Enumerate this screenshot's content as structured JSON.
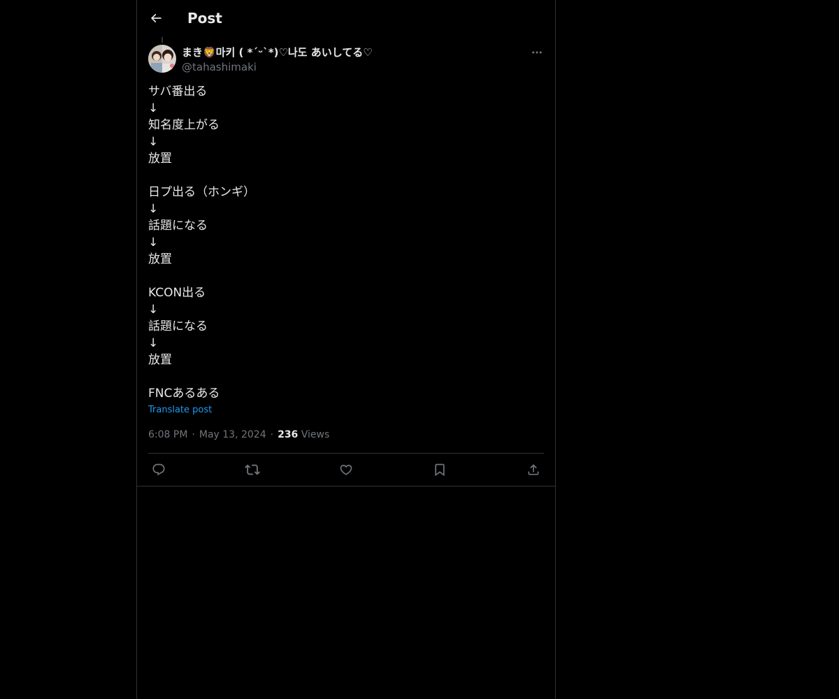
{
  "header": {
    "title": "Post",
    "back_icon": "back-arrow-icon"
  },
  "author": {
    "display_name": "まき🦁마키 ( *´ᵕ`*)♡나도 あいしてる♡",
    "handle": "@tahashimaki",
    "avatar": "avatar-photo"
  },
  "post": {
    "lines": [
      "サバ番出る",
      "↓",
      "知名度上がる",
      "↓",
      "放置",
      "",
      "日プ出る（ホンギ）",
      "↓",
      "話題になる",
      "↓",
      "放置",
      "",
      "KCON出る",
      "↓",
      "話題になる",
      "↓",
      "放置",
      "",
      "FNCあるある"
    ],
    "translate_label": "Translate post",
    "time": "6:08 PM",
    "date": "May 13, 2024",
    "views_count": "236",
    "views_label": "Views"
  },
  "actions": {
    "reply": "reply-icon",
    "repost": "repost-icon",
    "like": "like-icon",
    "bookmark": "bookmark-icon",
    "share": "share-icon"
  },
  "colors": {
    "background": "#000000",
    "text": "#e7e9ea",
    "secondary": "#71767b",
    "accent": "#1d9bf0",
    "border": "#2f3336"
  }
}
